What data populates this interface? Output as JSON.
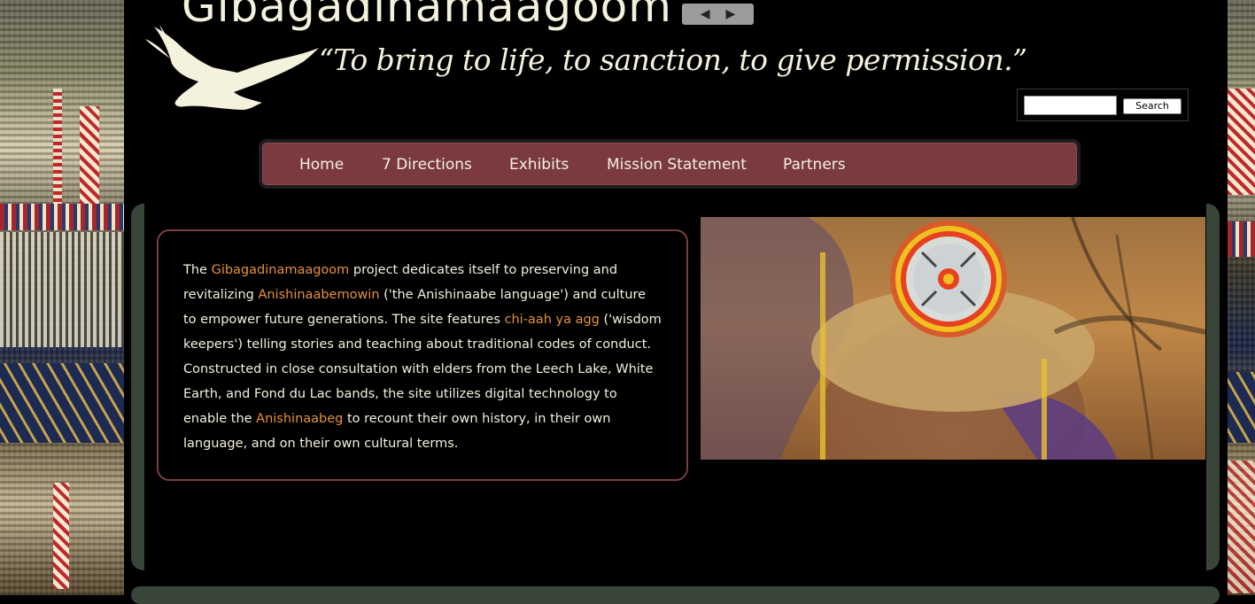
{
  "site": {
    "title": "Gibagadinamaagoom",
    "tagline": "“To bring to life, to sanction, to give permission.”"
  },
  "slider_controls": {
    "prev_icon": "triangle-left-icon",
    "next_icon": "triangle-right-icon"
  },
  "search": {
    "value": "",
    "button_label": "Search"
  },
  "nav": {
    "items": [
      {
        "label": "Home"
      },
      {
        "label": "7 Directions"
      },
      {
        "label": "Exhibits"
      },
      {
        "label": "Mission Statement"
      },
      {
        "label": "Partners"
      }
    ]
  },
  "intro": {
    "p1": "The ",
    "link1": "Gibagadinamaagoom",
    "p2": " project dedicates itself to preserving and revitalizing ",
    "link2": "Anishinaabemowin",
    "p3": " ('the Anishinaabe language') and culture to empower future generations. The site features ",
    "link3": "chi-aah ya agg",
    "p4": " ('wisdom keepers') telling stories and teaching about traditional codes of conduct. Constructed in close consultation with elders from the Leech Lake, White Earth, and Fond du Lac bands, the site utilizes digital technology to enable the ",
    "link4": "Anishinaabeg",
    "p5": " to recount their own history, in their own language, and on their own cultural terms."
  },
  "colors": {
    "nav_bg": "#7a3a3f",
    "link": "#e5913a",
    "text": "#f4f1dd",
    "panel_border": "#384538"
  }
}
